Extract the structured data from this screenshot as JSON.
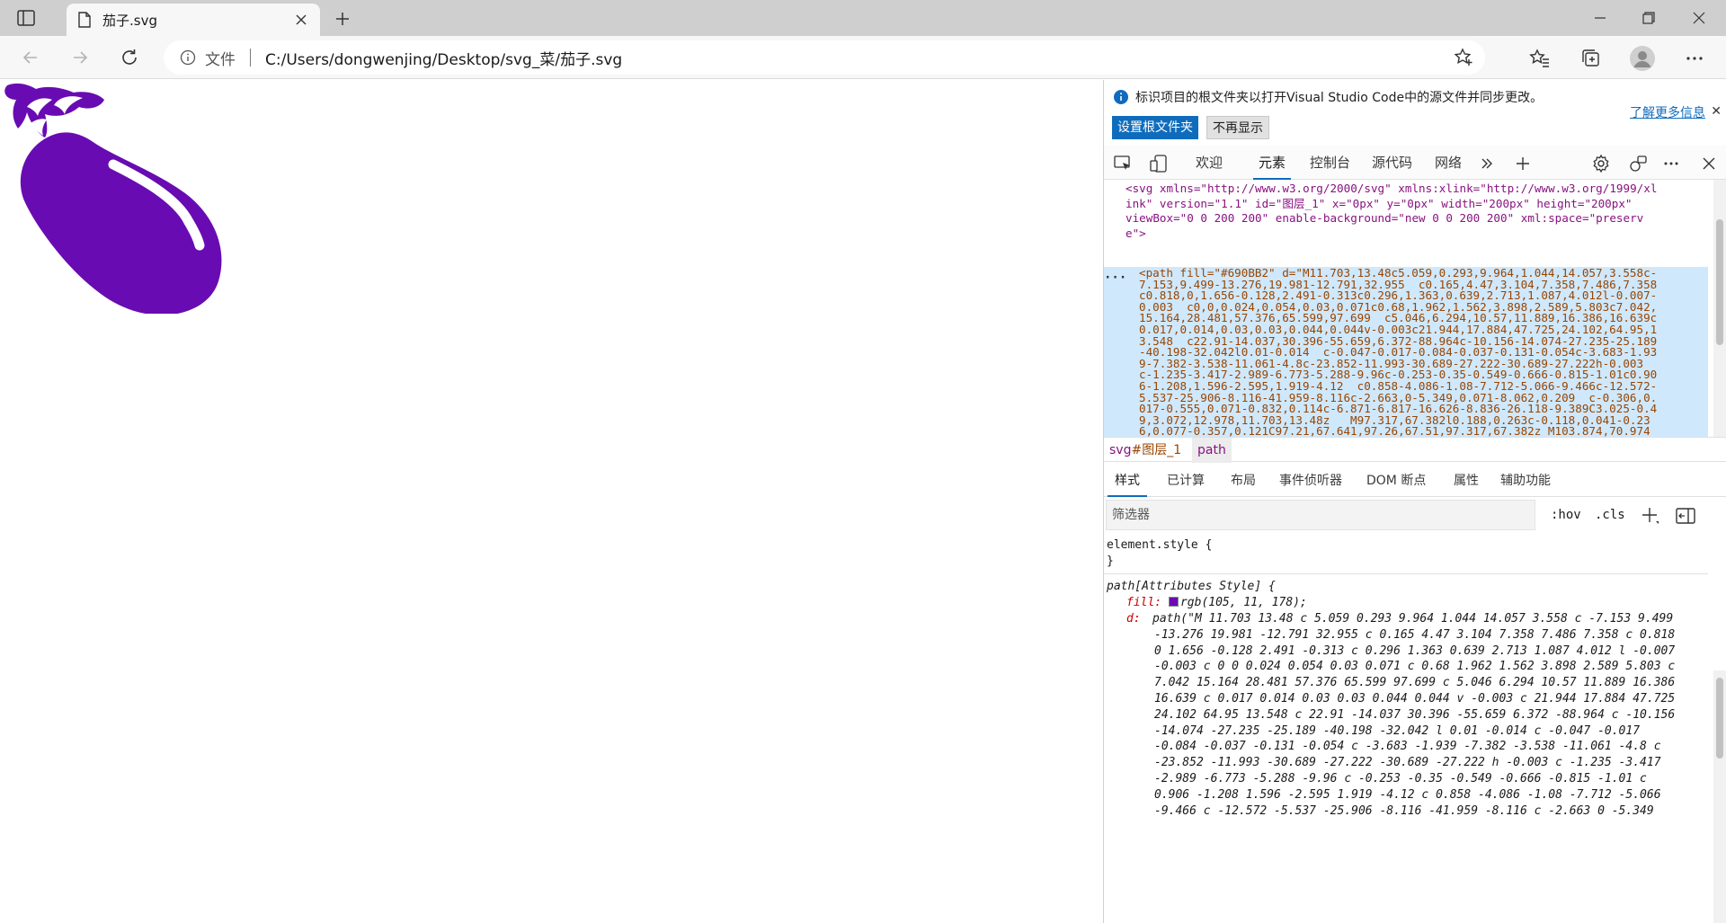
{
  "browser": {
    "tab_title": "茄子.svg",
    "address_scheme": "文件",
    "address_url": "C:/Users/dongwenjing/Desktop/svg_菜/茄子.svg"
  },
  "page": {
    "eggplant_fill": "#690BB2"
  },
  "devtools": {
    "infobar": {
      "message": "标识项目的根文件夹以打开Visual Studio Code中的源文件并同步更改。",
      "learn_more": "了解更多信息",
      "set_root_button": "设置根文件夹",
      "dont_show_button": "不再显示"
    },
    "tabs": [
      "欢迎",
      "元素",
      "控制台",
      "源代码",
      "网络"
    ],
    "active_tab": "元素",
    "dom_lines": [
      "<svg xmlns=\"http://www.w3.org/2000/svg\" xmlns:xlink=\"http://www.w3.org/1999/xl",
      "ink\" version=\"1.1\" id=\"图层_1\" x=\"0px\" y=\"0px\" width=\"200px\" height=\"200px\"",
      "viewBox=\"0 0 200 200\" enable-background=\"new 0 0 200 200\" xml:space=\"preserv",
      "e\">",
      "<path fill=\"#690BB2\" d=\"M11.703,13.48c5.059,0.293,9.964,1.044,14.057,3.558c-",
      "7.153,9.499-13.276,19.981-12.791,32.955  c0.165,4.47,3.104,7.358,7.486,7.358",
      "c0.818,0,1.656-0.128,2.491-0.313c0.296,1.363,0.639,2.713,1.087,4.012l-0.007-",
      "0.003  c0,0,0.024,0.054,0.03,0.071c0.68,1.962,1.562,3.898,2.589,5.803c7.042,",
      "15.164,28.481,57.376,65.599,97.699  c5.046,6.294,10.57,11.889,16.386,16.639c",
      "0.017,0.014,0.03,0.03,0.044,0.044v-0.003c21.944,17.884,47.725,24.102,64.95,1",
      "3.548  c22.91-14.037,30.396-55.659,6.372-88.964c-10.156-14.074-27.235-25.189",
      "-40.198-32.042l0.01-0.014  c-0.047-0.017-0.084-0.037-0.131-0.054c-3.683-1.93",
      "9-7.382-3.538-11.061-4.8c-23.852-11.993-30.689-27.222-30.689-27.222h-0.003",
      "c-1.235-3.417-2.989-6.773-5.288-9.96c-0.253-0.35-0.549-0.666-0.815-1.01c0.90",
      "6-1.208,1.596-2.595,1.919-4.12  c0.858-4.086-1.08-7.712-5.066-9.466c-12.572-",
      "5.537-25.906-8.116-41.959-8.116c-2.663,0-5.349,0.071-8.062,0.209  c-0.306,0.",
      "017-0.555,0.071-0.832,0.114c-6.871-6.817-16.626-8.836-26.118-9.389C3.025-0.4",
      "9,3.072,12.978,11.703,13.48z   M97.317,67.382l0.188,0.263c-0.118,0.041-0.23",
      "6,0.077-0.357,0.121C97.21,67.641,97.26,67.51,97.317,67.382z M103.874,70.974"
    ],
    "breadcrumbs": {
      "svg_tag": "svg",
      "svg_id": "#图层_1",
      "path": "path"
    },
    "style_tabs": [
      "样式",
      "已计算",
      "布局",
      "事件侦听器",
      "DOM 断点",
      "属性",
      "辅助功能"
    ],
    "filter_placeholder": "筛选器",
    "hov": ":hov",
    "cls": ".cls",
    "styles": {
      "element_style_open": "element.style {",
      "element_style_close": "}",
      "attr_selector": "path[Attributes Style] {",
      "fill_prop": "fill:",
      "fill_value": "rgb(105, 11, 178);",
      "d_prop": "d:",
      "d_lines": [
        "path(\"M 11.703 13.48 c 5.059 0.293 9.964 1.044 14.057 3.558 c -7.153 9.499",
        "-13.276 19.981 -12.791 32.955 c 0.165 4.47 3.104 7.358 7.486 7.358 c 0.818",
        "0 1.656 -0.128 2.491 -0.313 c 0.296 1.363 0.639 2.713 1.087 4.012 l -0.007",
        "-0.003 c 0 0 0.024 0.054 0.03 0.071 c 0.68 1.962 1.562 3.898 2.589 5.803 c",
        "7.042 15.164 28.481 57.376 65.599 97.699 c 5.046 6.294 10.57 11.889 16.386",
        "16.639 c 0.017 0.014 0.03 0.03 0.044 0.044 v -0.003 c 21.944 17.884 47.725",
        "24.102 64.95 13.548 c 22.91 -14.037 30.396 -55.659 6.372 -88.964 c -10.156",
        "-14.074 -27.235 -25.189 -40.198 -32.042 l 0.01 -0.014 c -0.047 -0.017",
        "-0.084 -0.037 -0.131 -0.054 c -3.683 -1.939 -7.382 -3.538 -11.061 -4.8 c",
        "-23.852 -11.993 -30.689 -27.222 -30.689 -27.222 h -0.003 c -1.235 -3.417",
        "-2.989 -6.773 -5.288 -9.96 c -0.253 -0.35 -0.549 -0.666 -0.815 -1.01 c",
        "0.906 -1.208 1.596 -2.595 1.919 -4.12 c 0.858 -4.086 -1.08 -7.712 -5.066",
        "-9.466 c -12.572 -5.537 -25.906 -8.116 -41.959 -8.116 c -2.663 0 -5.349"
      ]
    }
  }
}
